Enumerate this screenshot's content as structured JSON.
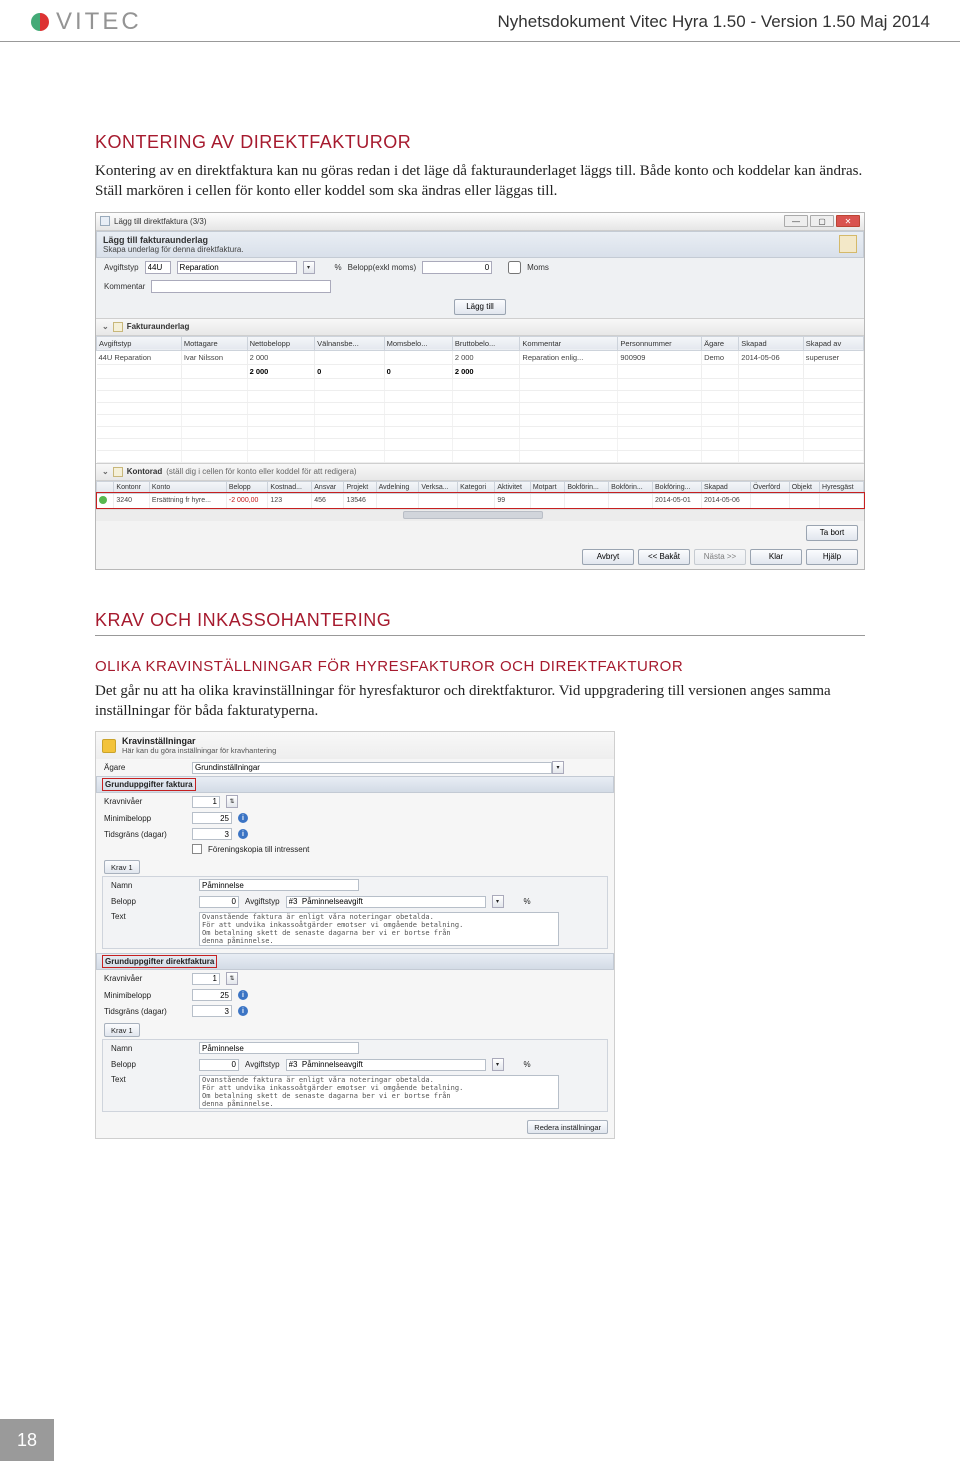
{
  "header": {
    "logo_text": "VITEC",
    "doc_title": "Nyhetsdokument Vitec Hyra 1.50 - Version 1.50 Maj 2014"
  },
  "section1": {
    "heading": "KONTERING AV DIREKTFAKTUROR",
    "para": "Kontering av en direktfaktura kan nu göras redan i det läge då fakturaunderlaget läggs till. Både konto och koddelar kan ändras. Ställ markören i cellen för konto eller koddel som ska ändras eller läggas till."
  },
  "ss1": {
    "window_title": "Lägg till direktfaktura (3/3)",
    "band1_title": "Lägg till fakturaunderlag",
    "band1_sub": "Skapa underlag för denna direktfaktura.",
    "form": {
      "avgiftstyp_label": "Avgiftstyp",
      "avgiftstyp_code": "44U",
      "avgiftstyp_text": "Reparation",
      "amount_icon": "%",
      "amount_label": "Belopp(exkl moms)",
      "amount_value": "0",
      "moms_label": "Moms",
      "kommentar_label": "Kommentar",
      "add_btn": "Lägg till"
    },
    "band2_title": "Fakturaunderlag",
    "grid1": {
      "headers": [
        "Avgiftstyp",
        "Mottagare",
        "Nettobelopp",
        "Välnansbe...",
        "Momsbelo...",
        "Bruttobelo...",
        "Kommentar",
        "Personnummer",
        "Ägare",
        "Skapad",
        "Skapad av"
      ],
      "rows": [
        [
          "44U   Reparation",
          "Ivar Nilsson",
          "2 000",
          "",
          "",
          "2 000",
          "Reparation enlig...",
          "900909",
          "Demo",
          "2014-05-06",
          "superuser"
        ],
        [
          "",
          "",
          "2 000",
          "0",
          "0",
          "2 000",
          "",
          "",
          "",
          "",
          ""
        ]
      ]
    },
    "kontrad_title": "Kontorad",
    "kontrad_hint": "(ställ dig i cellen för konto eller koddel för att redigera)",
    "grid2": {
      "headers": [
        "",
        "Kontonr",
        "Konto",
        "Belopp",
        "Kostnad...",
        "Ansvar",
        "Projekt",
        "Avdelning",
        "Verksa...",
        "Kategori",
        "Aktivitet",
        "Motpart",
        "Bokförin...",
        "Bokförin...",
        "Bokföring...",
        "Skapad",
        "Överförd",
        "Objekt",
        "Hyresgäst"
      ],
      "row": [
        "●",
        "3240",
        "Ersättning fr hyre...",
        "-2 000,00",
        "123",
        "456",
        "13546",
        "",
        "",
        "",
        "99",
        "",
        "",
        "",
        "2014-05-01",
        "2014-05-06",
        "",
        "",
        ""
      ]
    },
    "buttons": {
      "ta_bort": "Ta bort",
      "avbryt": "Avbryt",
      "bakat": "<< Bakåt",
      "nasta": "Nästa >>",
      "klar": "Klar",
      "hjalp": "Hjälp"
    }
  },
  "section2": {
    "heading": "KRAV OCH INKASSOHANTERING",
    "subheading": "OLIKA KRAVINSTÄLLNINGAR FÖR HYRESFAKTUROR OCH DIREKTFAKTUROR",
    "para": "Det går nu att ha olika kravinställningar för hyresfakturor och direktfakturor. Vid uppgradering till versionen anges samma inställningar för båda fakturatyperna."
  },
  "ss2": {
    "hdr_title": "Kravinställningar",
    "hdr_sub": "Här kan du göra inställningar för kravhantering",
    "owner_label": "Ägare",
    "owner_value": "Grundinställningar",
    "bar_grund_faktura": "Grunduppgifter faktura",
    "kravnivaer_label": "Kravnivåer",
    "kravnivaer_val": "1",
    "minimibelopp_label": "Minimibelopp",
    "minimibelopp_val": "25",
    "tidsgräns_label": "Tidsgräns (dagar)",
    "tidsgräns_val": "3",
    "famcheck_label": "Föreningskopia till intressent",
    "krav1_bar": "Krav 1",
    "namn_label": "Namn",
    "namn_val": "Påminnelse",
    "belopp_label": "Belopp",
    "belopp_val": "0",
    "avgiftstyp_label": "Avgiftstyp",
    "avgiftstyp_val": "#3  Påminnelseavgift",
    "text_label": "Text",
    "text_val": "Ovanstående faktura är enligt våra noteringar obetalda.\nFör att undvika inkassoåtgärder emotser vi omgående betalning.\nOm betalning skett de senaste dagarna ber vi er bortse från\ndenna påminnelse.",
    "bar_grund_direkt": "Grunduppgifter direktfaktura",
    "kravnivaer2_val": "1",
    "minimibelopp2_val": "25",
    "tidsgräns2_val": "3",
    "krav1b_bar": "Krav 1",
    "namn2_val": "Påminnelse",
    "belopp2_val": "0",
    "avgiftstyp2_val": "#3  Påminnelseavgift",
    "text2_val": "Ovanstående faktura är enligt våra noteringar obetalda.\nFör att undvika inkassoåtgärder emotser vi omgående betalning.\nOm betalning skett de senaste dagarna ber vi er bortse från\ndenna påminnelse.",
    "redera_btn": "Redera inställningar"
  },
  "page_number": "18"
}
